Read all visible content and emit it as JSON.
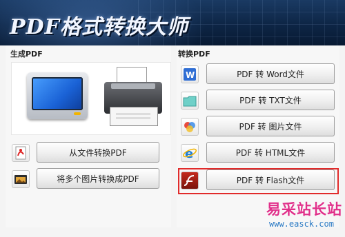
{
  "app": {
    "title": "PDF格式转换大师"
  },
  "left": {
    "label": "生成PDF",
    "buttons": [
      {
        "label": "从文件转换PDF",
        "icon": "pdf-file-icon"
      },
      {
        "label": "将多个图片转换成PDF",
        "icon": "image-folder-icon"
      }
    ]
  },
  "right": {
    "label": "转换PDF",
    "buttons": [
      {
        "label": "PDF 转 Word文件",
        "icon": "word-icon"
      },
      {
        "label": "PDF 转 TXT文件",
        "icon": "txt-folder-icon"
      },
      {
        "label": "PDF 转 图片文件",
        "icon": "image-icon"
      },
      {
        "label": "PDF 转 HTML文件",
        "icon": "ie-icon"
      },
      {
        "label": "PDF 转 Flash文件",
        "icon": "flash-icon"
      }
    ]
  },
  "watermark": {
    "cn": "易采站长站",
    "url": "www.easck.com"
  },
  "colors": {
    "banner": "#0d2545",
    "highlight": "#e12b2b",
    "watermark_cn": "#e0308a",
    "watermark_url": "#2a7ac4"
  }
}
